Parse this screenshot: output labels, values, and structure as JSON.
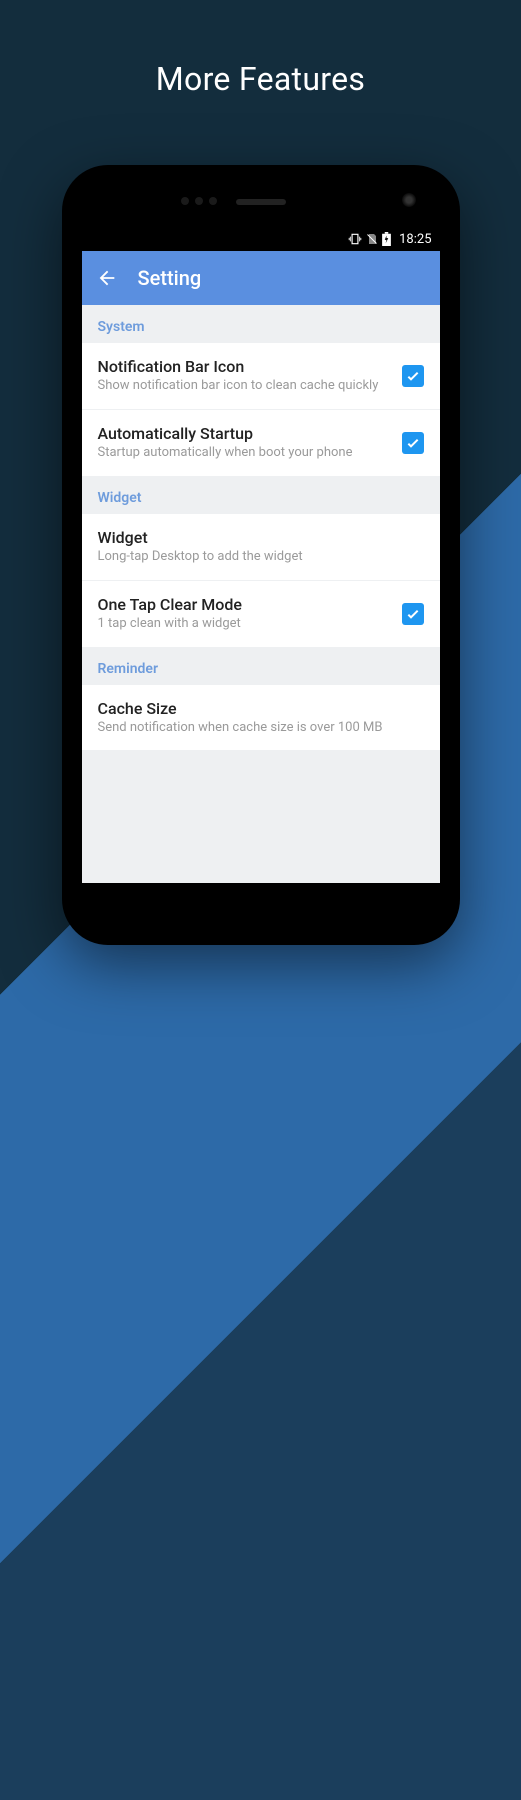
{
  "promo": {
    "title": "More Features"
  },
  "statusbar": {
    "time": "18:25"
  },
  "appbar": {
    "title": "Setting"
  },
  "sections": [
    {
      "header": "System",
      "items": [
        {
          "title": "Notification Bar Icon",
          "subtitle": "Show notification bar icon to clean cache quickly",
          "checked": true
        },
        {
          "title": "Automatically Startup",
          "subtitle": "Startup automatically when boot your phone",
          "checked": true
        }
      ]
    },
    {
      "header": "Widget",
      "items": [
        {
          "title": "Widget",
          "subtitle": "Long-tap Desktop to add the widget",
          "checked": null
        },
        {
          "title": "One Tap Clear Mode",
          "subtitle": "1 tap clean with a widget",
          "checked": true
        }
      ]
    },
    {
      "header": "Reminder",
      "items": [
        {
          "title": "Cache Size",
          "subtitle": "Send notification when cache size is over 100 MB",
          "checked": null
        }
      ]
    }
  ]
}
